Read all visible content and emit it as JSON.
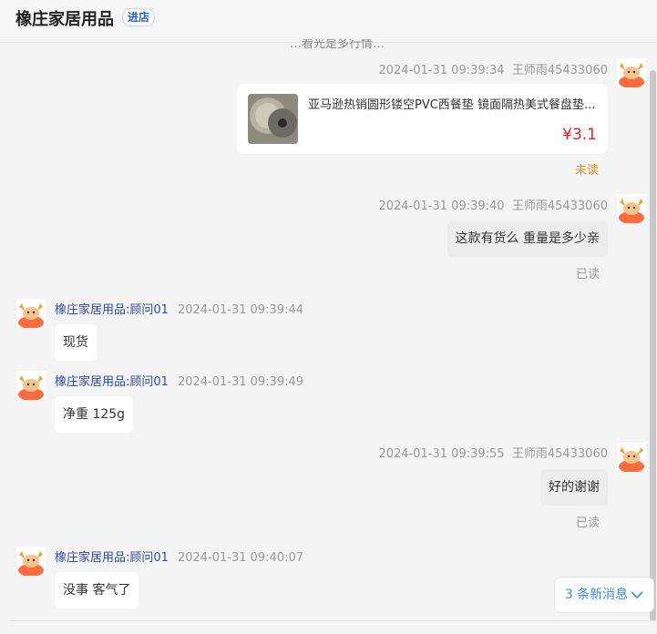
{
  "header": {
    "shop_name": "橡庄家居用品",
    "enter_label": "进店"
  },
  "truncated_line": "…看光是多行情…",
  "product": {
    "title": "亚马逊热销圆形镂空PVC西餐垫 镜面隔热美式餐盘垫...",
    "price": "¥3.1"
  },
  "messages": [
    {
      "type": "mine",
      "time": "2024-01-31 09:39:34",
      "sender": "王师雨45433060",
      "status": "未读"
    },
    {
      "type": "mine",
      "time": "2024-01-31 09:39:40",
      "sender": "王师雨45433060",
      "text": "这款有货么  重量是多少亲",
      "status": "已读"
    },
    {
      "type": "theirs",
      "sender": "橡庄家居用品:顾问01",
      "time": "2024-01-31 09:39:44",
      "text": "现货"
    },
    {
      "type": "theirs",
      "sender": "橡庄家居用品:顾问01",
      "time": "2024-01-31 09:39:49",
      "text": "净重  125g"
    },
    {
      "type": "mine",
      "time": "2024-01-31 09:39:55",
      "sender": "王师雨45433060",
      "text": "好的谢谢",
      "status": "已读"
    },
    {
      "type": "theirs",
      "sender": "橡庄家居用品:顾问01",
      "time": "2024-01-31 09:40:07",
      "text": "没事  客气了"
    }
  ],
  "new_messages": {
    "label": "3 条新消息",
    "icon": "chevron-down-icon"
  },
  "colors": {
    "accent": "#3c8fe0",
    "price": "#e52222",
    "unread": "#f08a24",
    "seller_name": "#2e4d9e"
  }
}
